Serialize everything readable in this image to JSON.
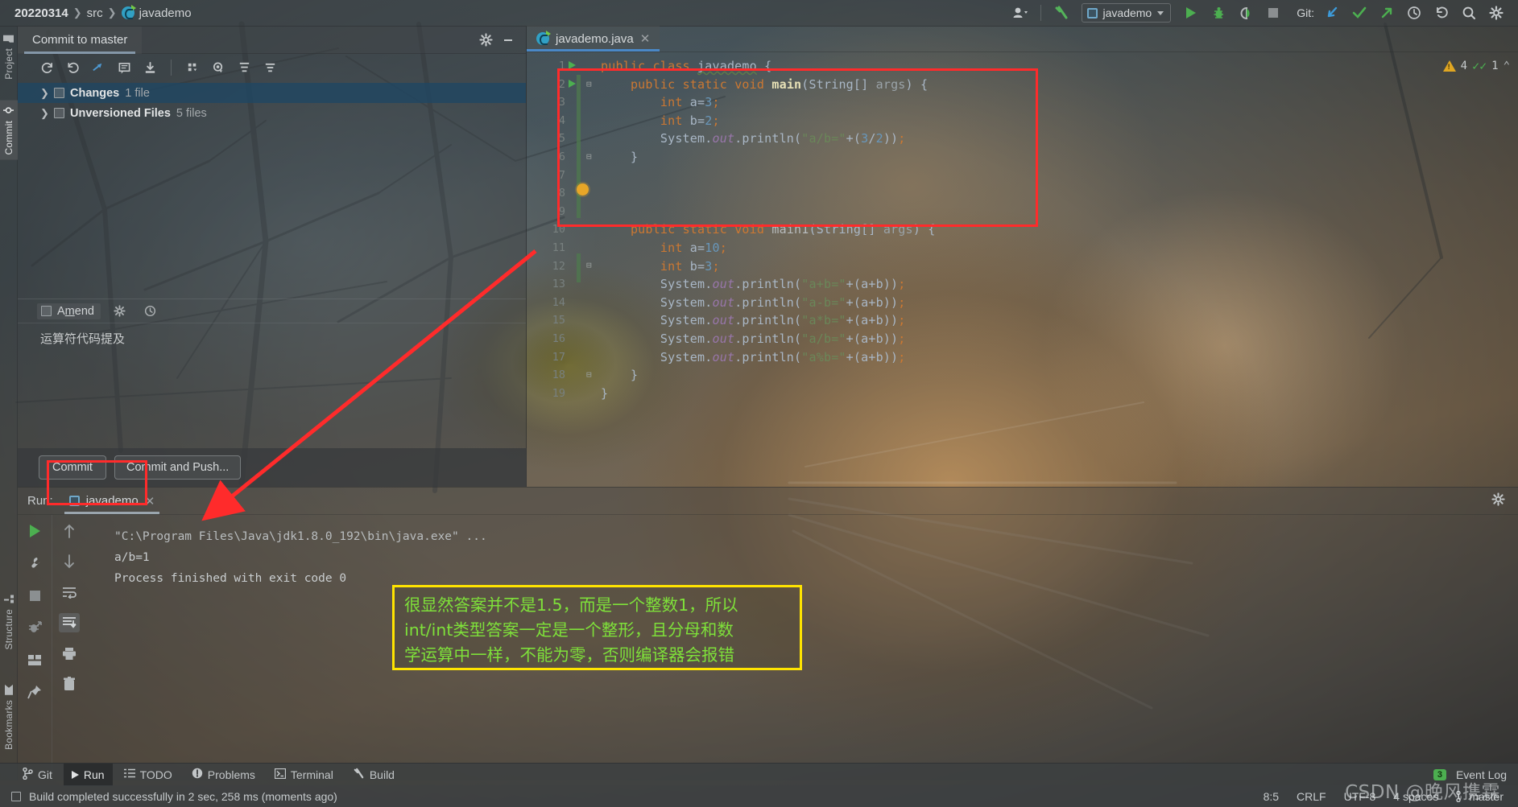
{
  "toolbar": {
    "breadcrumb": [
      "20220314",
      "src",
      "javademo"
    ],
    "run_config": "javademo",
    "git_label": "Git:",
    "icons": [
      "user-icon",
      "build-hammer-icon",
      "run-icon",
      "debug-icon",
      "run-coverage-icon",
      "stop-icon",
      "update-project-icon",
      "commit-icon",
      "push-icon",
      "history-icon",
      "rollback-icon",
      "search-everywhere-icon",
      "settings-icon"
    ]
  },
  "left_strip": {
    "tabs": [
      "Project",
      "Commit",
      "Structure",
      "Bookmarks"
    ],
    "active": "Commit"
  },
  "commit_panel": {
    "tab_title": "Commit to master",
    "gear_icon": "gear-icon",
    "minimize_icon": "minimize-icon",
    "toolbar_icons": [
      "refresh-icon",
      "rollback-icon",
      "show-diff-icon",
      "comment-icon",
      "shelve-icon",
      "group-by-icon",
      "preview-icon",
      "expand-all-icon",
      "collapse-all-icon"
    ],
    "rows": [
      {
        "name": "Changes",
        "count": "1 file",
        "selected": true
      },
      {
        "name": "Unversioned Files",
        "count": "5 files",
        "selected": false
      }
    ],
    "amend_label": "Amend",
    "amend_checked": false,
    "commit_message": "运算符代码提及",
    "buttons": [
      "Commit",
      "Commit and Push..."
    ]
  },
  "editor": {
    "tab_name": "javademo.java",
    "close_icon": "close-icon",
    "warnings": "4",
    "weak_warnings": "1",
    "lines": [
      {
        "n": 1,
        "runmark": true,
        "text": "public class javademo {"
      },
      {
        "n": 2,
        "runmark": true,
        "text": "    public static void main(String[] args) {"
      },
      {
        "n": 3,
        "runmark": false,
        "text": "        int a=3;"
      },
      {
        "n": 4,
        "runmark": false,
        "text": "        int b=2;"
      },
      {
        "n": 5,
        "runmark": false,
        "text": "        System.out.println(\"a/b=\"+(3/2));"
      },
      {
        "n": 6,
        "runmark": false,
        "text": "    }"
      },
      {
        "n": 7,
        "runmark": false,
        "text": ""
      },
      {
        "n": 8,
        "runmark": false,
        "text": ""
      },
      {
        "n": 9,
        "runmark": false,
        "text": ""
      },
      {
        "n": 10,
        "runmark": false,
        "text": "    public static void main1(String[] args) {"
      },
      {
        "n": 11,
        "runmark": false,
        "text": "        int a=10;"
      },
      {
        "n": 12,
        "runmark": false,
        "text": "        int b=3;"
      },
      {
        "n": 13,
        "runmark": false,
        "text": "        System.out.println(\"a+b=\"+(a+b));"
      },
      {
        "n": 14,
        "runmark": false,
        "text": "        System.out.println(\"a-b=\"+(a+b));"
      },
      {
        "n": 15,
        "runmark": false,
        "text": "        System.out.println(\"a*b=\"+(a+b));"
      },
      {
        "n": 16,
        "runmark": false,
        "text": "        System.out.println(\"a/b=\"+(a+b));"
      },
      {
        "n": 17,
        "runmark": false,
        "text": "        System.out.println(\"a%b=\"+(a+b));"
      },
      {
        "n": 18,
        "runmark": false,
        "text": "    }"
      },
      {
        "n": 19,
        "runmark": false,
        "text": "}"
      }
    ]
  },
  "run_window": {
    "label": "Run:",
    "tab_name": "javademo",
    "close_icon": "close-icon",
    "gear_icon": "gear-icon",
    "toolbar_icons": [
      "rerun-icon",
      "settings-wrench-icon",
      "stop-icon",
      "debug-icon",
      "layout-icon",
      "pin-icon",
      "scroll-up-icon",
      "scroll-down-icon",
      "soft-wrap-icon",
      "scroll-to-end-icon",
      "print-icon",
      "clear-all-icon"
    ],
    "console": [
      "\"C:\\Program Files\\Java\\jdk1.8.0_192\\bin\\java.exe\" ...",
      "a/b=1",
      "",
      "Process finished with exit code 0"
    ]
  },
  "annotation": {
    "line1": "很显然答案并不是1.5，而是一个整数1，所以",
    "line2": "int/int类型答案一定是一个整形，且分母和数",
    "line3": "学运算中一样，不能为零，否则编译器会报错",
    "border_color": "#ffe400",
    "text_color": "#7ee03a"
  },
  "highlight_boxes": {
    "color": "#ff2b2b",
    "arrow_color": "#ff2b2b"
  },
  "bottom_bar": {
    "items": [
      {
        "label": "Git",
        "icon": "git-branch-icon",
        "active": false
      },
      {
        "label": "Run",
        "icon": "run-icon",
        "active": true
      },
      {
        "label": "TODO",
        "icon": "todo-icon",
        "active": false
      },
      {
        "label": "Problems",
        "icon": "problems-icon",
        "active": false
      },
      {
        "label": "Terminal",
        "icon": "terminal-icon",
        "active": false
      },
      {
        "label": "Build",
        "icon": "build-hammer-icon",
        "active": false
      }
    ],
    "event_log": "Event Log",
    "event_count": "3"
  },
  "status_bar": {
    "message": "Build completed successfully in 2 sec, 258 ms (moments ago)",
    "caret": "8:5",
    "line_sep": "CRLF",
    "encoding": "UTF-8",
    "indent": "4 spaces",
    "branch": "master"
  },
  "watermark": "CSDN @晚风携霖"
}
